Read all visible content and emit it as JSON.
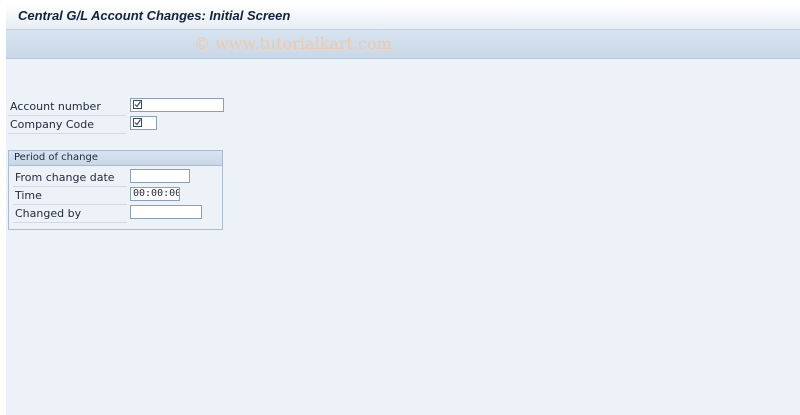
{
  "window": {
    "title": "Central G/L Account Changes: Initial Screen",
    "watermark": "© www.tutorialkart.com"
  },
  "form": {
    "account_number": {
      "label": "Account number",
      "value": "",
      "required": true
    },
    "company_code": {
      "label": "Company Code",
      "value": "",
      "required": true
    }
  },
  "period_of_change": {
    "title": "Period of change",
    "from_change_date": {
      "label": "From change date",
      "value": ""
    },
    "time": {
      "label": "Time",
      "value": "00:00:00"
    },
    "changed_by": {
      "label": "Changed by",
      "value": ""
    }
  },
  "icons": {
    "required": "required-checkbox-icon"
  },
  "colors": {
    "background": "#edf2f8",
    "title_text": "#14233b",
    "group_border": "#a9bcd3"
  }
}
